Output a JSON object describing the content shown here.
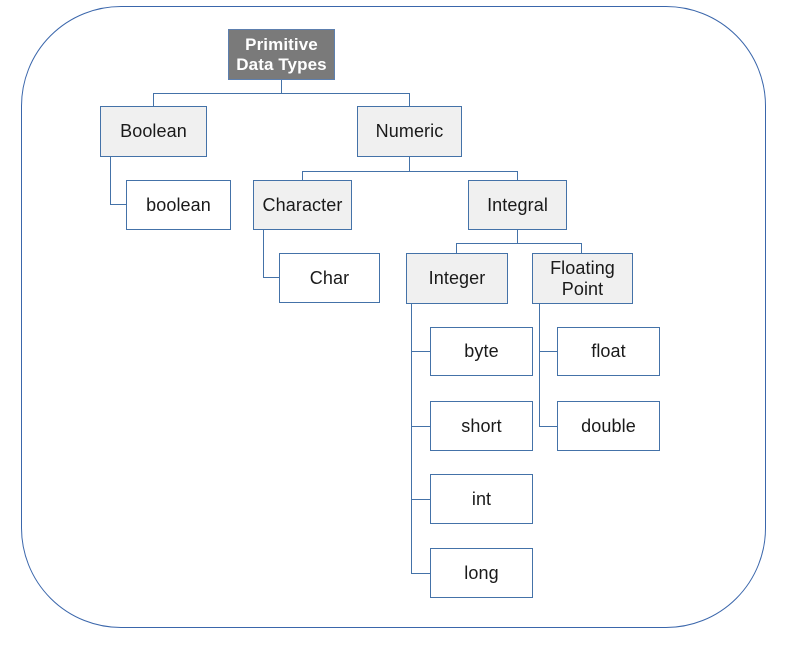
{
  "diagram": {
    "title": "Primitive Data Types hierarchy",
    "colors": {
      "frame_border": "#3a66ab",
      "node_border": "#4472a8",
      "branch_fill": "#f0f0f0",
      "leaf_fill": "#ffffff",
      "root_fill": "#7a7a7a",
      "root_text": "#ffffff",
      "node_text": "#1a1a1a"
    },
    "nodes": {
      "root": "Primitive\nData Types",
      "root_line1": "Primitive",
      "root_line2": "Data Types",
      "boolean_branch": "Boolean",
      "boolean_leaf": "boolean",
      "numeric": "Numeric",
      "character": "Character",
      "char_leaf": "Char",
      "integral": "Integral",
      "integer": "Integer",
      "floating_point_line1": "Floating",
      "floating_point_line2": "Point",
      "byte": "byte",
      "short": "short",
      "int": "int",
      "long": "long",
      "float": "float",
      "double": "double"
    }
  },
  "chart_data": {
    "type": "diagram",
    "title": "Primitive Data Types",
    "layout": "tree",
    "root": "Primitive Data Types",
    "edges": [
      [
        "Primitive Data Types",
        "Boolean"
      ],
      [
        "Primitive Data Types",
        "Numeric"
      ],
      [
        "Boolean",
        "boolean"
      ],
      [
        "Numeric",
        "Character"
      ],
      [
        "Numeric",
        "Integral"
      ],
      [
        "Character",
        "Char"
      ],
      [
        "Integral",
        "Integer"
      ],
      [
        "Integral",
        "Floating Point"
      ],
      [
        "Integer",
        "byte"
      ],
      [
        "Integer",
        "short"
      ],
      [
        "Integer",
        "int"
      ],
      [
        "Integer",
        "long"
      ],
      [
        "Floating Point",
        "float"
      ],
      [
        "Floating Point",
        "double"
      ]
    ],
    "leaves": [
      "boolean",
      "Char",
      "byte",
      "short",
      "int",
      "long",
      "float",
      "double"
    ],
    "branches": [
      "Boolean",
      "Numeric",
      "Character",
      "Integral",
      "Integer",
      "Floating Point"
    ]
  }
}
